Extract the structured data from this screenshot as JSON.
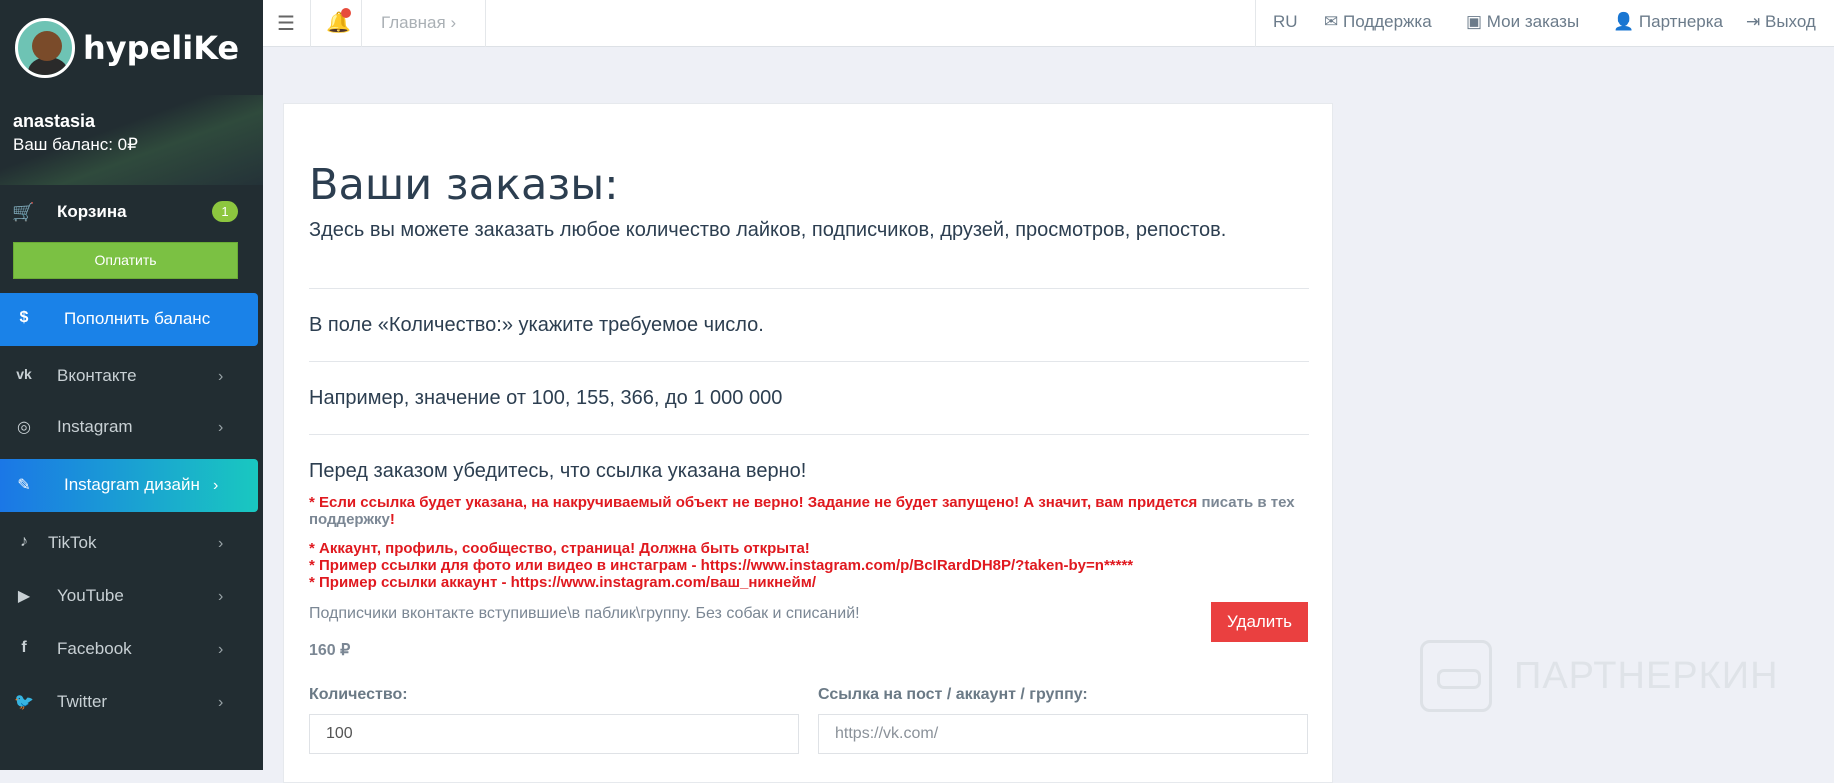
{
  "sidebar": {
    "logo_text": "hypeliKe",
    "user_name": "anastasia",
    "balance": "Ваш баланс: 0₽",
    "cart_label": "Корзина",
    "cart_count": "1",
    "pay_label": "Оплатить",
    "items": [
      {
        "label": "Пополнить баланс",
        "icon": "dollar-icon"
      },
      {
        "label": "Вконтакте",
        "icon": "vk-icon"
      },
      {
        "label": "Instagram",
        "icon": "instagram-icon"
      },
      {
        "label": "Instagram дизайн",
        "icon": "brush-icon"
      },
      {
        "label": "TikTok",
        "icon": "tiktok-icon"
      },
      {
        "label": "YouTube",
        "icon": "youtube-icon"
      },
      {
        "label": "Facebook",
        "icon": "facebook-icon"
      },
      {
        "label": "Twitter",
        "icon": "twitter-icon"
      }
    ]
  },
  "topbar": {
    "breadcrumb": "Главная",
    "lang": "RU",
    "support": "Поддержка",
    "orders": "Мои заказы",
    "partner": "Партнерка",
    "logout": "Выход"
  },
  "main": {
    "title": "Ваши заказы:",
    "subtitle": "Здесь вы можете заказать любое количество лайков, подписчиков, друзей, просмотров, репостов.",
    "line1": "В поле «Количество:» укажите требуемое число.",
    "line2": "Например, значение от 100, 155, 366, до 1 000 000",
    "line3": "Перед заказом убедитесь, что ссылка указана верно!",
    "warn1_red": "* Если ссылка будет указана, на накручиваемый объект не верно! Задание не будет запущено! А значит, вам придется ",
    "warn1_gray": "писать в тех поддержку",
    "warn1_end": "!",
    "warn2": "* Аккаунт, профиль, сообщество, страница! Должна быть открыта!",
    "warn3": "* Пример ссылки для фото или видео в инстаграм - https://www.instagram.com/p/BcIRardDH8P/?taken-by=n*****",
    "warn4": "* Пример ссылки аккаунт - https://www.instagram.com/ваш_никнейм/",
    "order_desc": "Подписчики вконтакте вступившие\\в паблик\\группу. Без собак и списаний!",
    "price": "160 ₽",
    "delete_label": "Удалить",
    "qty_label": "Количество:",
    "qty_value": "100",
    "link_label": "Ссылка на пост / аккаунт / группу:",
    "link_placeholder": "https://vk.com/"
  },
  "watermark": "ПАРТНЕРКИН",
  "colors": {
    "sidebar_bg": "#222d32",
    "accent_blue": "#1a82e8",
    "pay_green": "#7bc143",
    "delete_red": "#ea4040",
    "warn_red": "#e0191f"
  }
}
